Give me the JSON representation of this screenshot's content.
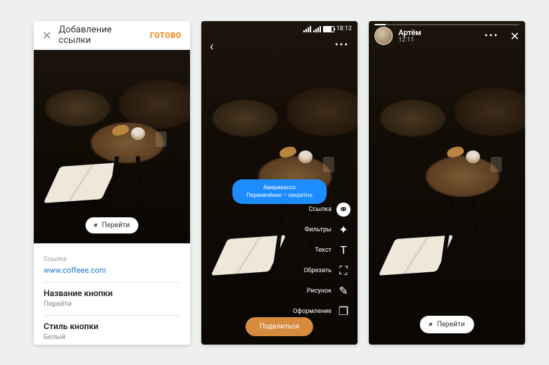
{
  "screen1": {
    "header": {
      "title": "Добавление ссылки",
      "done": "готово"
    },
    "preview_button": {
      "label": "Перейти"
    },
    "link_field": {
      "label": "Ссылка",
      "value": "www.coffeee.com"
    },
    "button_name": {
      "title": "Название кнопки",
      "value": "Перейти"
    },
    "button_style": {
      "title": "Стиль кнопки",
      "value": "Белый"
    }
  },
  "screen2": {
    "status": {
      "time": "18:12"
    },
    "blue_button": {
      "line1": "Америкаccо",
      "line2": "Переначённо – секретно"
    },
    "tools": [
      {
        "label": "Ссылка",
        "icon": "link-icon",
        "glyph": "⚭",
        "active": true
      },
      {
        "label": "Фильтры",
        "icon": "sparkle-icon",
        "glyph": "✦",
        "active": false
      },
      {
        "label": "Текст",
        "icon": "text-icon",
        "glyph": "T",
        "active": false
      },
      {
        "label": "Обрезать",
        "icon": "crop-icon",
        "glyph": "⛶",
        "active": false
      },
      {
        "label": "Рисунок",
        "icon": "brush-icon",
        "glyph": "✎",
        "active": false
      },
      {
        "label": "Оформление",
        "icon": "layout-icon",
        "glyph": "❒",
        "active": false
      }
    ],
    "publish": "Поделиться"
  },
  "screen3": {
    "user": {
      "name": "Артём",
      "time": "12:11"
    },
    "cta": {
      "label": "Перейти"
    }
  }
}
